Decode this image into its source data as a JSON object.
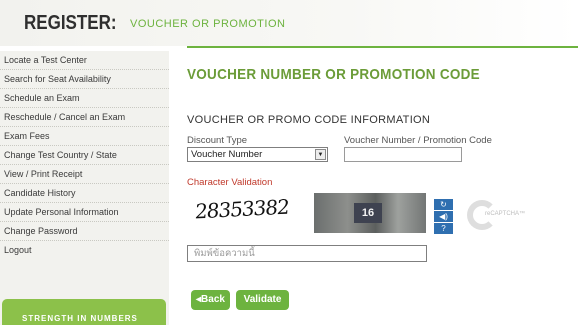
{
  "header": {
    "title": "REGISTER:",
    "subtitle": "VOUCHER OR PROMOTION"
  },
  "sidebar": {
    "items": [
      {
        "label": "Locate a Test Center"
      },
      {
        "label": "Search for Seat Availability"
      },
      {
        "label": "Schedule an Exam"
      },
      {
        "label": "Reschedule / Cancel an Exam"
      },
      {
        "label": "Exam Fees"
      },
      {
        "label": "Change Test Country / State"
      },
      {
        "label": "View / Print Receipt"
      },
      {
        "label": "Candidate History"
      },
      {
        "label": "Update Personal Information"
      },
      {
        "label": "Change Password"
      },
      {
        "label": "Logout"
      }
    ],
    "promo_label": "STRENGTH IN NUMBERS"
  },
  "main": {
    "page_title": "VOUCHER NUMBER OR PROMOTION CODE",
    "section_title": "VOUCHER OR PROMO CODE INFORMATION",
    "discount_type_label": "Discount Type",
    "discount_type_value": "Voucher Number",
    "voucher_label": "Voucher Number / Promotion Code",
    "voucher_value": "",
    "character_validation_label": "Character Validation",
    "captcha": {
      "word_1": "28353382",
      "word_2": "16"
    },
    "captcha_answer_value": "พิมพ์ข้อความนี้",
    "back_label": "◂Back",
    "validate_label": "Validate"
  },
  "captcha_controls": {
    "refresh_icon": "refresh-icon",
    "audio_icon": "audio-icon",
    "help_icon": "help-icon",
    "recaptcha_logo_text": "reCAPTCHA™"
  },
  "colors": {
    "accent_green": "#6db33f",
    "title_green": "#6b9c38",
    "validation_red": "#c0392b",
    "captcha_blue": "#2f6fb0"
  }
}
